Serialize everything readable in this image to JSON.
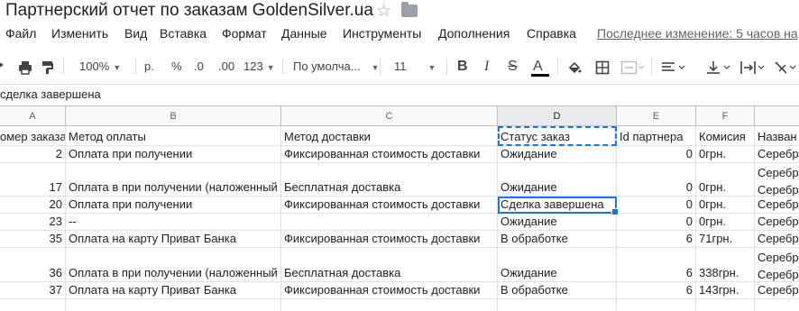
{
  "title": "Партнерский отчет по заказам GoldenSilver.ua",
  "menu": [
    "Файл",
    "Изменить",
    "Вид",
    "Вставка",
    "Формат",
    "Данные",
    "Инструменты",
    "Дополнения",
    "Справка"
  ],
  "last_edit": "Последнее изменение: 5 часов на",
  "toolbar": {
    "zoom": "100%",
    "currency": "р.",
    "percent": "%",
    "dec_decrease": ".0",
    "dec_increase": ".00",
    "format_more": "123",
    "font": "По умолча...",
    "font_size": "11",
    "bold": "B",
    "italic": "I",
    "strike": "S",
    "text_color": "A"
  },
  "formula_bar": {
    "value": "сделка завершена"
  },
  "columns": [
    {
      "letter": "A"
    },
    {
      "letter": "B"
    },
    {
      "letter": "C"
    },
    {
      "letter": "D"
    },
    {
      "letter": "E"
    },
    {
      "letter": "F"
    }
  ],
  "header_row": [
    "омер заказа",
    "Метод оплаты",
    "Метод доставки",
    "Статус заказ",
    "Id партнера",
    "Комисия",
    "Назван"
  ],
  "rows": [
    {
      "order": "2",
      "payment": "Оплата при получении",
      "delivery": "Фиксированная стоимость доставки",
      "status": "Ожидание",
      "partner": "0",
      "commission": "0грн.",
      "name": [
        "Серебр"
      ]
    },
    {
      "order": "17",
      "payment": "Оплата в при получении (наложенный",
      "delivery": "Бесплатная доставка",
      "status": "Ожидание",
      "partner": "0",
      "commission": "0грн.",
      "name": [
        "Серебр",
        "Серебр"
      ]
    },
    {
      "order": "20",
      "payment": "Оплата при получении",
      "delivery": "Фиксированная стоимость доставки",
      "status": "Сделка завершена",
      "partner": "0",
      "commission": "0грн.",
      "name": [
        "Серебр"
      ]
    },
    {
      "order": "23",
      "payment": "--",
      "delivery": "",
      "status": "Ожидание",
      "partner": "0",
      "commission": "0грн.",
      "name": [
        "Серебр"
      ]
    },
    {
      "order": "35",
      "payment": "Оплата на карту Приват Банка",
      "delivery": "Фиксированная стоимость доставки",
      "status": "В обработке",
      "partner": "6",
      "commission": "71грн.",
      "name": [
        "Серебр"
      ]
    },
    {
      "order": "36",
      "payment": "Оплата в при получении (наложенный",
      "delivery": "Бесплатная доставка",
      "status": "Ожидание",
      "partner": "6",
      "commission": "338грн.",
      "name": [
        "Серебр",
        "Серебр"
      ]
    },
    {
      "order": "37",
      "payment": "Оплата на карту Приват Банка",
      "delivery": "Фиксированная стоимость доставки",
      "status": "В обработке",
      "partner": "6",
      "commission": "143грн.",
      "name": [
        "Серебр"
      ]
    }
  ],
  "colors": {
    "selection": "#1a73e8",
    "header_bg": "#f8f9fa",
    "grid_line": "#e2e2e2"
  }
}
